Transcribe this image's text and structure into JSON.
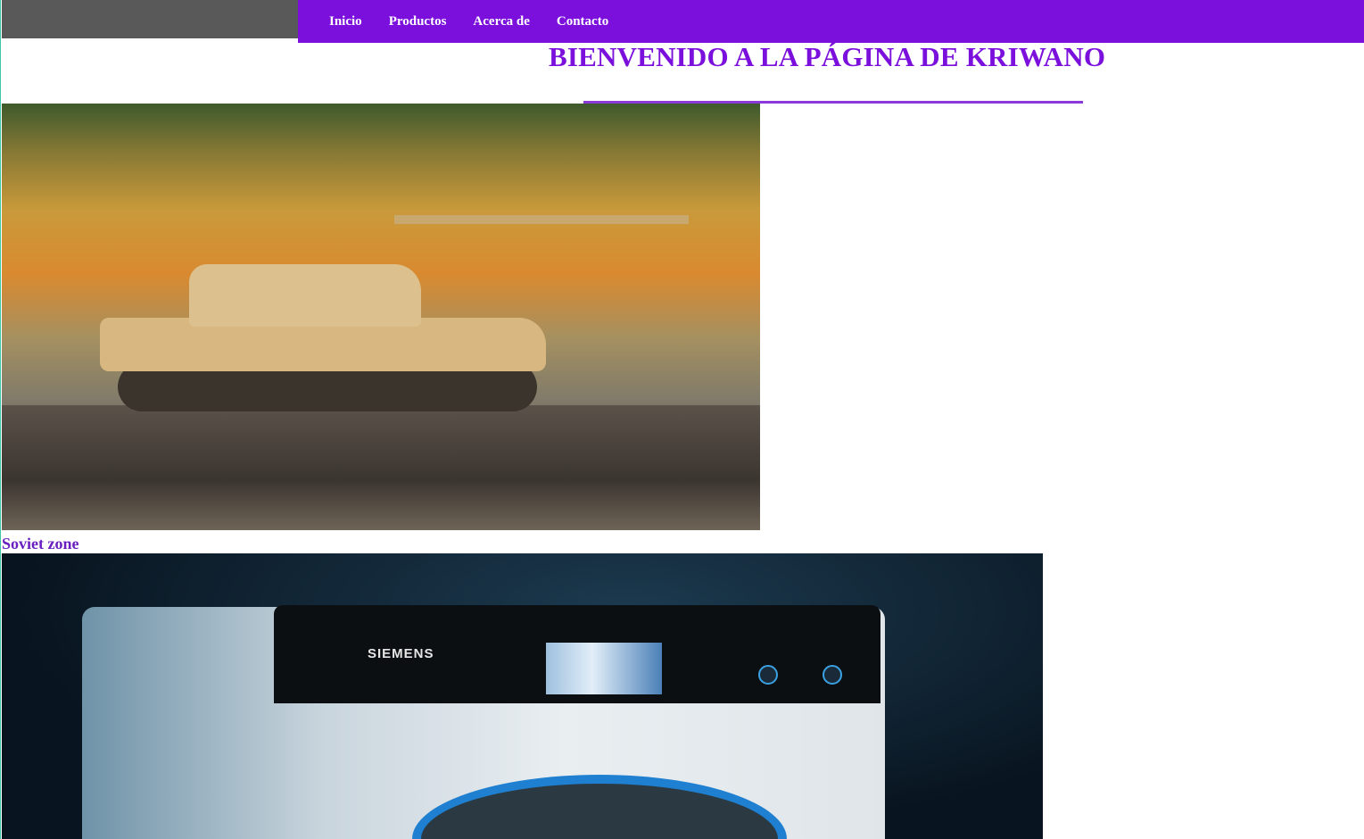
{
  "nav": {
    "items": [
      {
        "label": "Inicio"
      },
      {
        "label": "Productos"
      },
      {
        "label": "Acerca de"
      },
      {
        "label": "Contacto"
      }
    ]
  },
  "header": {
    "title": "BIENVENIDO A LA PÁGINA DE KRIWANO"
  },
  "content": {
    "image1_caption": "Soviet zone",
    "image2_brand": "SIEMENS"
  },
  "colors": {
    "accent": "#7b10dd",
    "topbar": "#595959"
  }
}
